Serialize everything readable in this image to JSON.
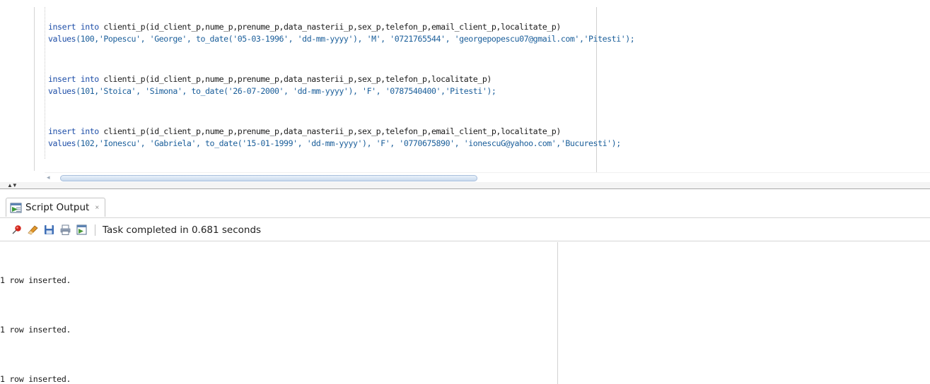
{
  "editor": {
    "statements": [
      {
        "insert": {
          "keyword": "insert into",
          "rest": " clienti_p(id_client_p,nume_p,prenume_p,data_nasterii_p,sex_p,telefon_p,email_client_p,localitate_p)"
        },
        "values": {
          "keyword": "values",
          "rest": "(100,'Popescu', 'George', to_date('05-03-1996', 'dd-mm-yyyy'), 'M', '0721765544', 'georgepopescu07@gmail.com','Pitesti');"
        }
      },
      {
        "insert": {
          "keyword": "insert into",
          "rest": " clienti_p(id_client_p,nume_p,prenume_p,data_nasterii_p,sex_p,telefon_p,localitate_p)"
        },
        "values": {
          "keyword": "values",
          "rest": "(101,'Stoica', 'Simona', to_date('26-07-2000', 'dd-mm-yyyy'), 'F', '0787540400','Pitesti');"
        }
      },
      {
        "insert": {
          "keyword": "insert into",
          "rest": " clienti_p(id_client_p,nume_p,prenume_p,data_nasterii_p,sex_p,telefon_p,email_client_p,localitate_p)"
        },
        "values": {
          "keyword": "values",
          "rest": "(102,'Ionescu', 'Gabriela', to_date('15-01-1999', 'dd-mm-yyyy'), 'F', '0770675890', 'ionescuG@yahoo.com','Bucuresti');"
        }
      }
    ],
    "scrollbar_left_arrow": "◂",
    "splitter_arrows": "▲▼"
  },
  "output_panel": {
    "tab": {
      "label": "Script Output",
      "close": "×",
      "icon": "script-output-icon"
    },
    "toolbar": {
      "buttons": [
        {
          "icon": "pin-icon",
          "color": "#d2261d"
        },
        {
          "icon": "eraser-icon",
          "color": "#e0962a"
        },
        {
          "icon": "save-icon",
          "color": "#3f6fb6"
        },
        {
          "icon": "print-icon",
          "color": "#6f7f94"
        },
        {
          "icon": "save-output-icon",
          "color": "#4a9a3a"
        }
      ],
      "status": "Task completed in 0.681 seconds"
    },
    "output_lines": [
      "1 row inserted.",
      "1 row inserted.",
      "1 row inserted."
    ]
  }
}
